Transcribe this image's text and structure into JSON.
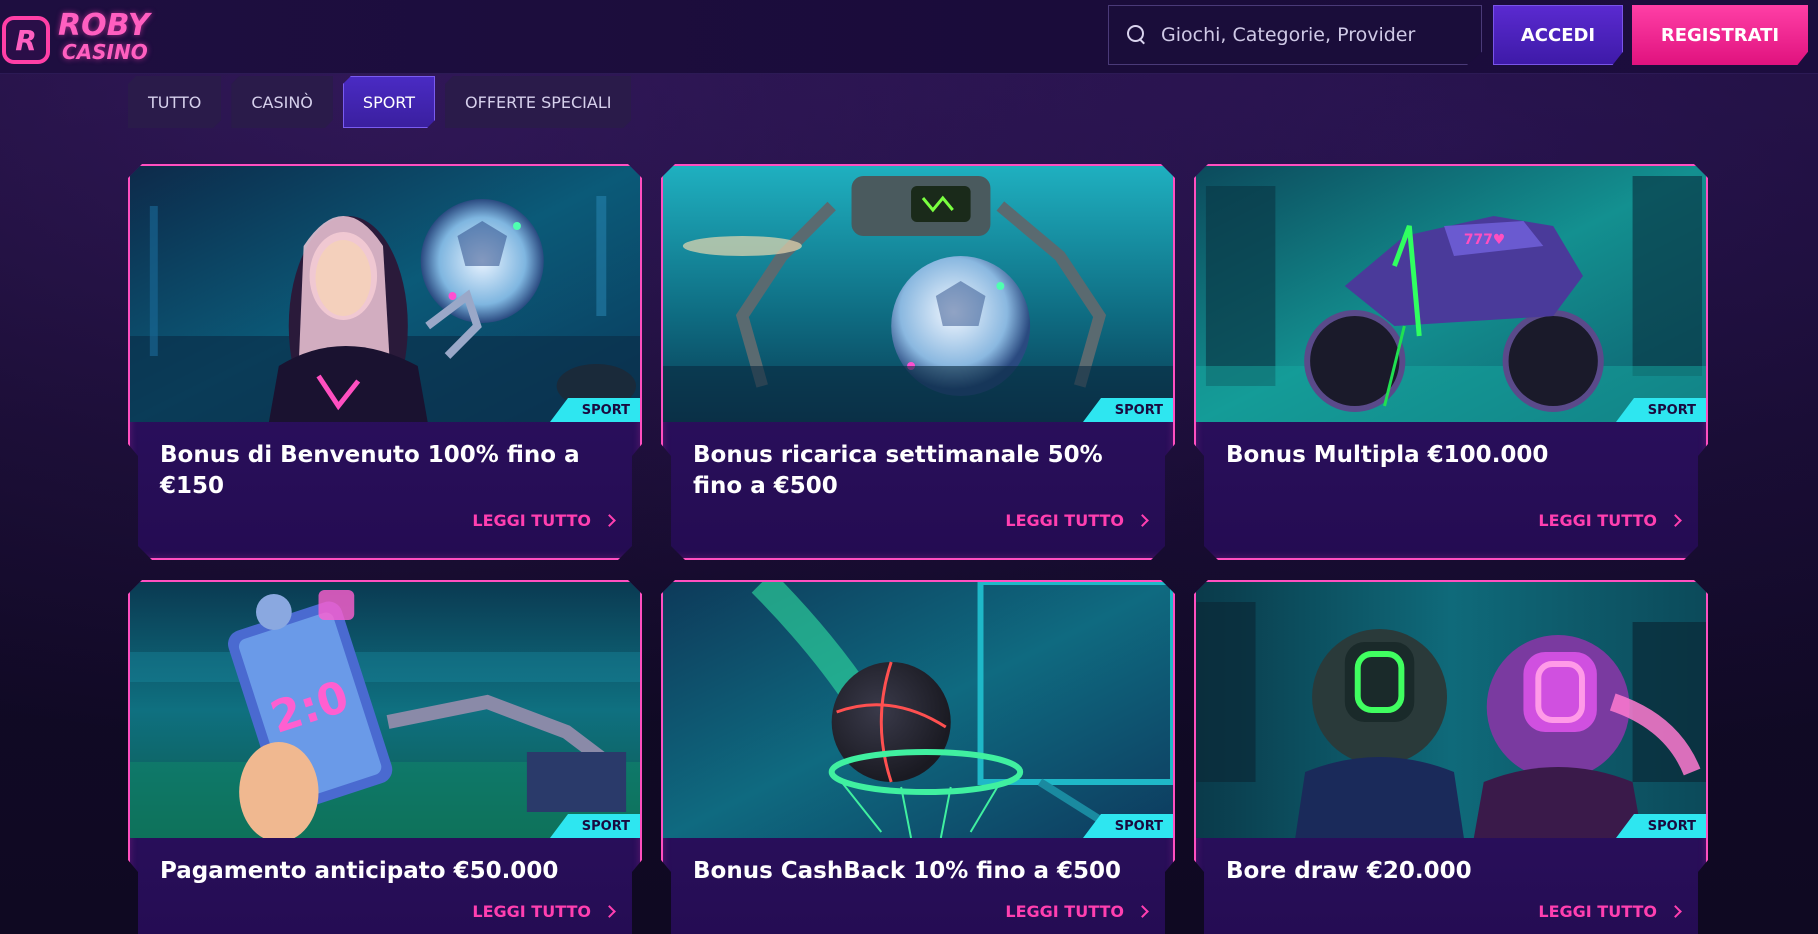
{
  "brand": {
    "line1": "ROBY",
    "line2": "CASINO",
    "mark": "R"
  },
  "header": {
    "search_placeholder": "Giochi, Categorie, Provider",
    "login_label": "ACCEDI",
    "register_label": "REGISTRATI"
  },
  "tabs": [
    {
      "label": "TUTTO",
      "active": false
    },
    {
      "label": "CASINÒ",
      "active": false
    },
    {
      "label": "SPORT",
      "active": true
    },
    {
      "label": "OFFERTE SPECIALI",
      "active": false
    }
  ],
  "cards": [
    {
      "title": "Bonus di Benvenuto 100% fino a €150",
      "badge": "SPORT",
      "link": "LEGGI TUTTO",
      "image": "cyber-woman-soccer-ball"
    },
    {
      "title": "Bonus ricarica settimanale 50% fino a €500",
      "badge": "SPORT",
      "link": "LEGGI TUTTO",
      "image": "robot-drone-soccer-ball"
    },
    {
      "title": "Bonus Multipla €100.000",
      "badge": "SPORT",
      "link": "LEGGI TUTTO",
      "image": "neon-motorcycle"
    },
    {
      "title": "Pagamento anticipato €50.000",
      "badge": "SPORT",
      "link": "LEGGI TUTTO",
      "image": "phone-score-stadium"
    },
    {
      "title": "Bonus CashBack 10% fino a €500",
      "badge": "SPORT",
      "link": "LEGGI TUTTO",
      "image": "basketball-hoop"
    },
    {
      "title": "Bore draw €20.000",
      "badge": "SPORT",
      "link": "LEGGI TUTTO",
      "image": "helmeted-riders"
    }
  ],
  "colors": {
    "accent_pink": "#ff3fa6",
    "accent_purple": "#5a2ad0",
    "badge_cyan": "#2ee6f0",
    "card_border": "#ff4fc0",
    "background": "#150b2e"
  }
}
